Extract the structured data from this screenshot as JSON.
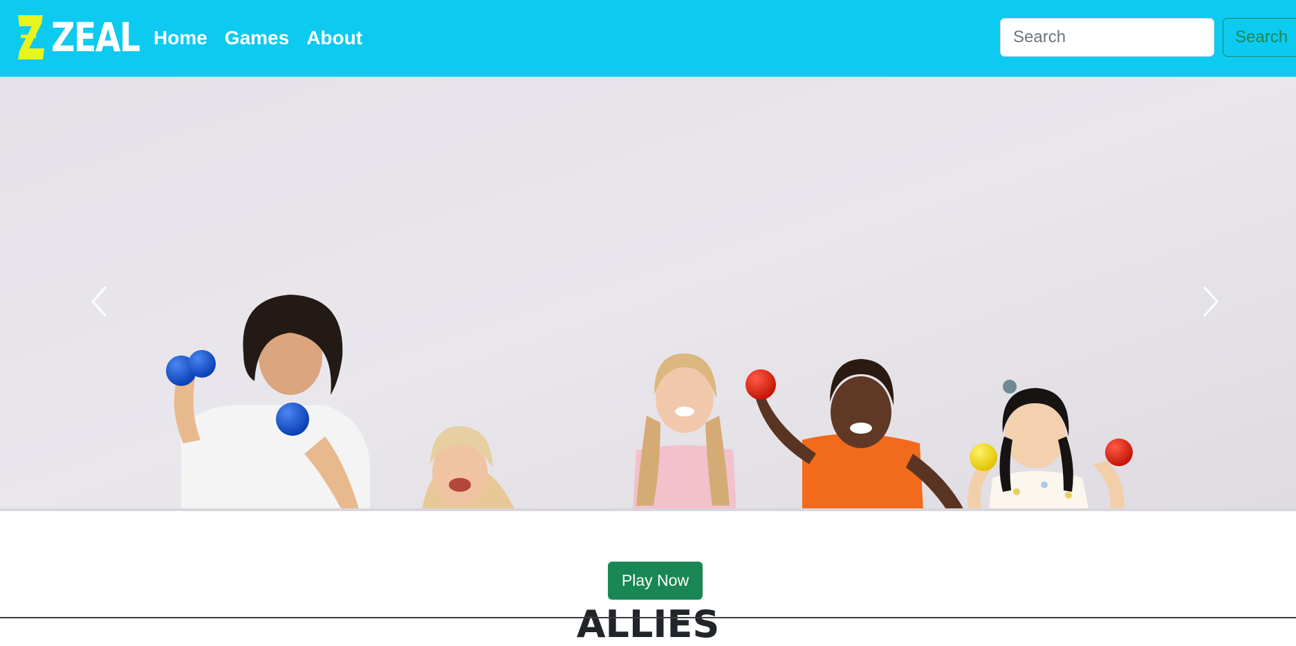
{
  "brand": {
    "name": "ZEAL",
    "logo_color": "#e8f51b"
  },
  "nav": {
    "items": [
      {
        "label": "Home"
      },
      {
        "label": "Games"
      },
      {
        "label": "About"
      }
    ],
    "background": "#0dcaf0"
  },
  "search": {
    "placeholder": "Search",
    "button_label": "Search"
  },
  "carousel": {
    "prev_icon": "chevron-left-icon",
    "next_icon": "chevron-right-icon",
    "slide_description_visual_only": true
  },
  "main": {
    "play_button_label": "Play Now",
    "heading": "ALLIES"
  },
  "colors": {
    "accent_green": "#198754",
    "navbar_cyan": "#0dcaf0"
  }
}
